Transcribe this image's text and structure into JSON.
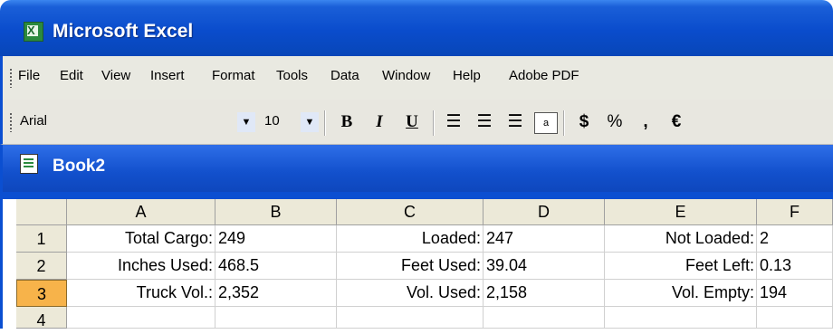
{
  "app": {
    "title": "Microsoft Excel",
    "icon": "excel-icon"
  },
  "menu": [
    "File",
    "Edit",
    "View",
    "Insert",
    "Format",
    "Tools",
    "Data",
    "Window",
    "Help",
    "Adobe PDF"
  ],
  "toolbar": {
    "font_name": "Arial",
    "font_size": "10",
    "bold": "B",
    "italic": "I",
    "underline": "U",
    "currency": "$",
    "percent": "%",
    "comma": ",",
    "euro": "€"
  },
  "workbook": {
    "title": "Book2"
  },
  "columns": [
    "A",
    "B",
    "C",
    "D",
    "E",
    "F"
  ],
  "rows": [
    {
      "num": "1",
      "cells": [
        "Total Cargo:",
        "249",
        "Loaded:",
        "247",
        "Not Loaded:",
        "2"
      ]
    },
    {
      "num": "2",
      "cells": [
        "Inches Used:",
        "468.5",
        "Feet Used:",
        "39.04",
        "Feet Left:",
        "0.13"
      ]
    },
    {
      "num": "3",
      "cells": [
        "Truck Vol.:",
        "2,352",
        "Vol. Used:",
        "2,158",
        "Vol. Empty:",
        "194"
      ]
    },
    {
      "num": "4",
      "cells": [
        "",
        "",
        "",
        "",
        "",
        ""
      ]
    }
  ],
  "selected_row": "3",
  "colors": {
    "title_blue": "#0a4ccc",
    "selected_row_header": "#f7b34a"
  }
}
